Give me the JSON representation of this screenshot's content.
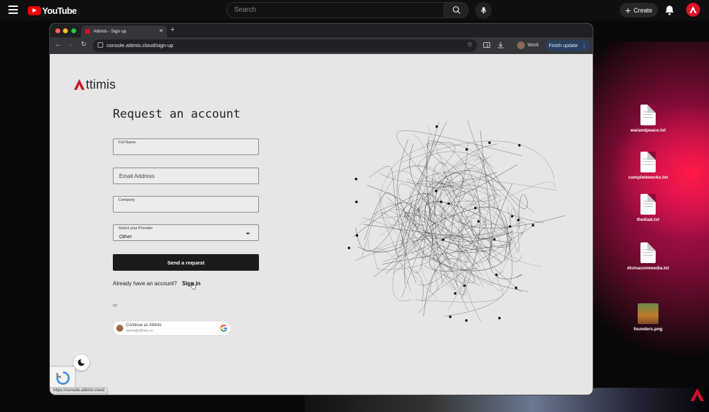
{
  "youtube": {
    "logo_text": "YouTube",
    "search_placeholder": "Search",
    "create_label": "Create"
  },
  "browser": {
    "tab_title": "Attimis - Sign up",
    "url": "console.attimis.cloud/sign-up",
    "profile_label": "Work",
    "finish_update_label": "Finish update",
    "status_url": "https://console.attimis.cloud"
  },
  "page": {
    "brand": "ttimis",
    "heading": "Request an account",
    "fields": {
      "full_name_label": "Full Name",
      "email_placeholder": "Email Address",
      "company_label": "Company",
      "provider_label": "Select your Provider",
      "provider_value": "Other"
    },
    "send_label": "Send a request",
    "already_text": "Already have an account?",
    "signin_label": "Sign in",
    "or_text": "or",
    "continue_title": "Continue as Attimis",
    "continue_email": "demo@attimis.co"
  },
  "desktop_files": [
    {
      "name": "warandpeace.txt",
      "type": "document"
    },
    {
      "name": "completeworks.txt",
      "type": "document"
    },
    {
      "name": "theiliad.txt",
      "type": "document"
    },
    {
      "name": "divinacommedia.txt",
      "type": "document"
    },
    {
      "name": "founders.png",
      "type": "image"
    }
  ],
  "colors": {
    "brand_red": "#d0102a",
    "button_dark": "#1b1b1b",
    "page_bg": "#e6e6e6",
    "youtube_red": "#ff0000",
    "finish_update_bg": "#2a3f5e"
  }
}
